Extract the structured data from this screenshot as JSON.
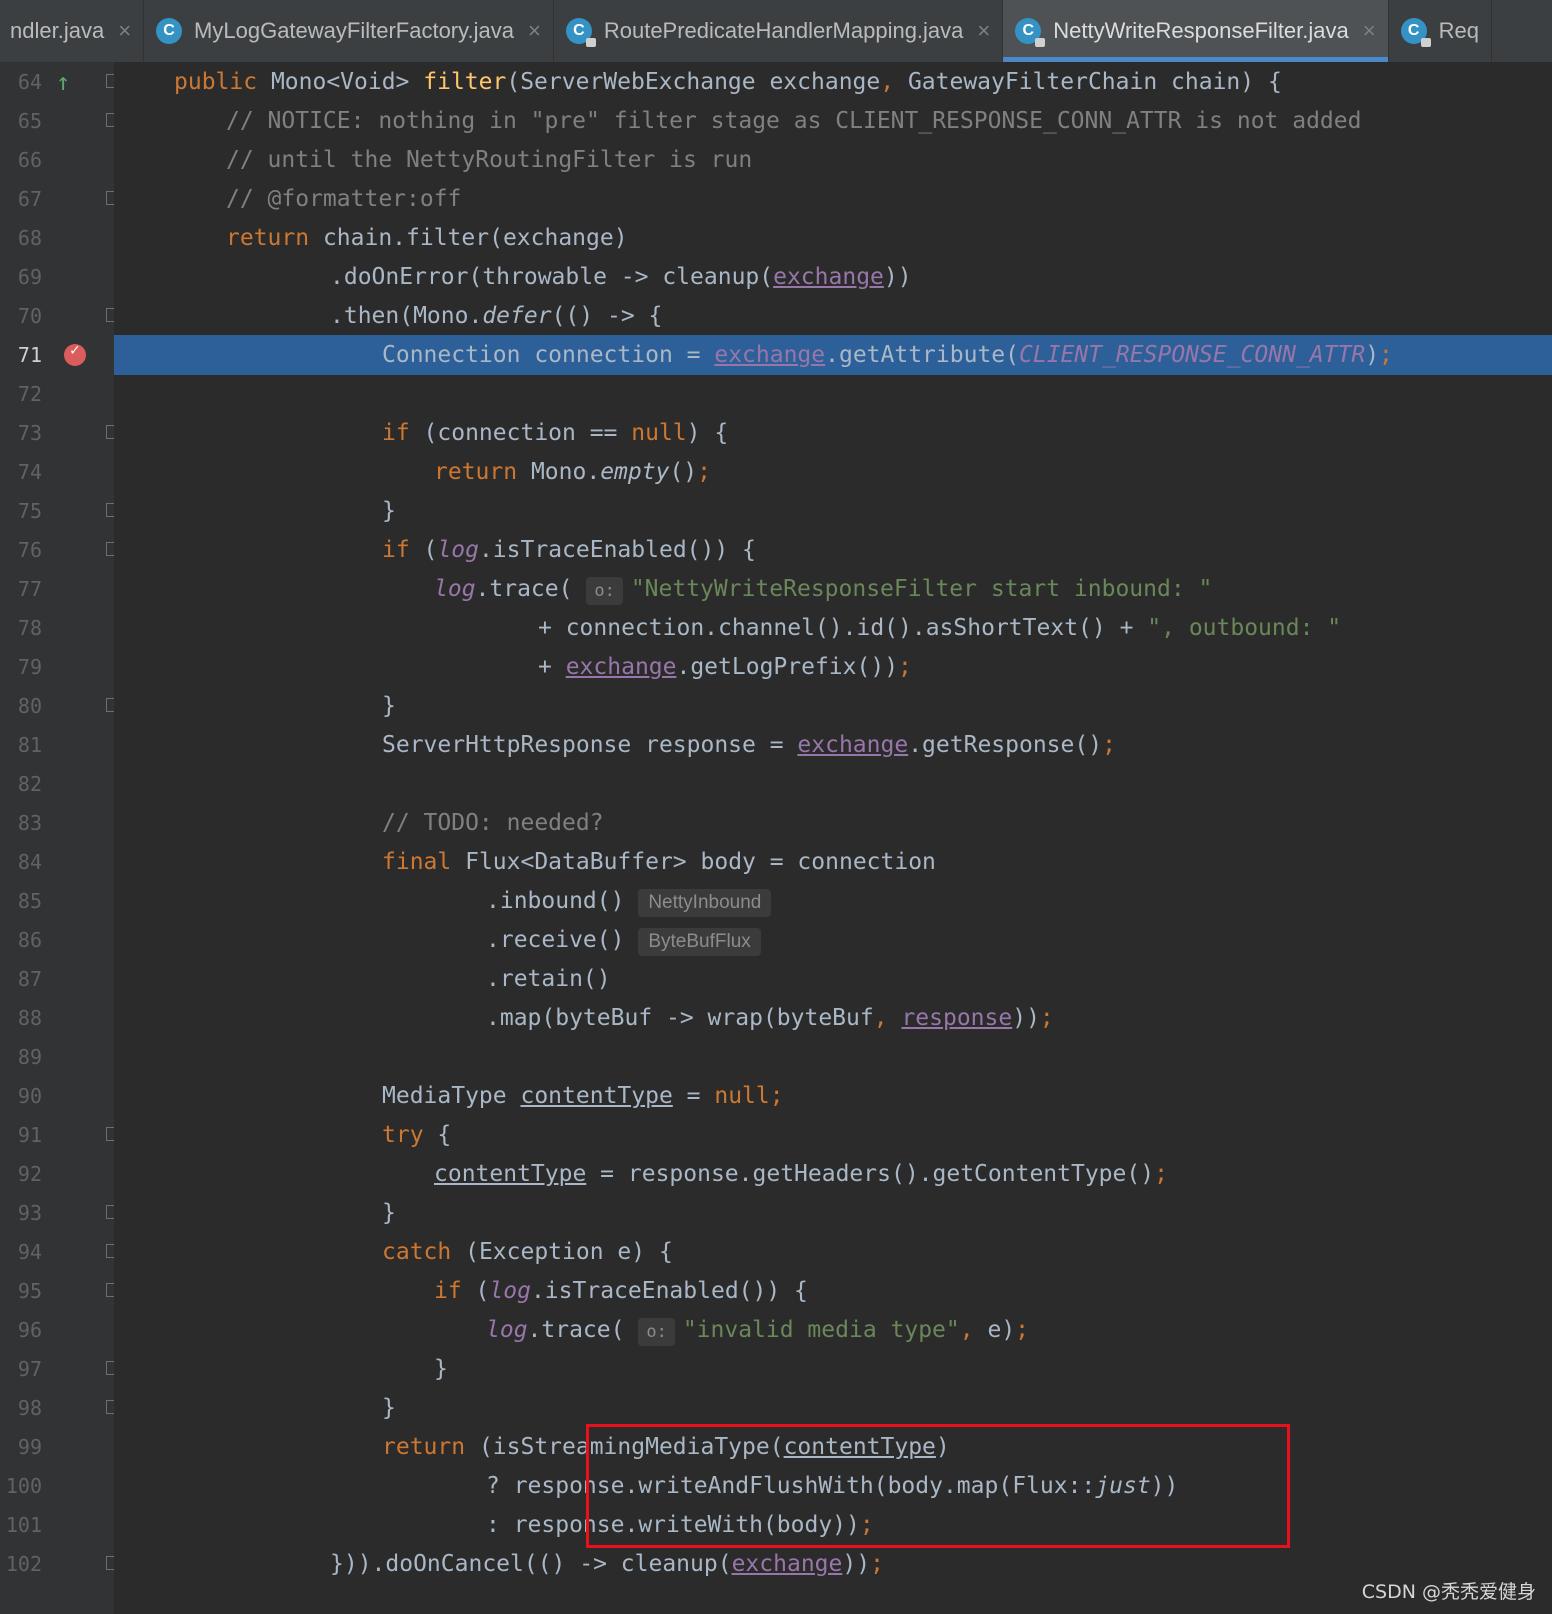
{
  "tabs": [
    {
      "label": "ndler.java",
      "icon": null,
      "active": false,
      "closable": true
    },
    {
      "label": "MyLogGatewayFilterFactory.java",
      "icon": "class-icon",
      "active": false,
      "closable": true
    },
    {
      "label": "RoutePredicateHandlerMapping.java",
      "icon": "locked-class-icon",
      "active": false,
      "closable": true
    },
    {
      "label": "NettyWriteResponseFilter.java",
      "icon": "locked-class-icon",
      "active": true,
      "closable": true
    },
    {
      "label": "Req",
      "icon": "locked-class-icon",
      "active": false,
      "closable": false
    }
  ],
  "tab_icon_glyph": "C",
  "close_glyph": "×",
  "current_line": 71,
  "breakpoint_line": 71,
  "override_marker_line": 64,
  "lines": [
    {
      "n": 64,
      "indent": 1,
      "tokens": [
        [
          "kw",
          "public "
        ],
        [
          "",
          "Mono<Void> "
        ],
        [
          "fn",
          "filter"
        ],
        [
          "",
          "(ServerWebExchange exchange"
        ],
        [
          "kw",
          ", "
        ],
        [
          "",
          "GatewayFilterChain chain) {"
        ]
      ]
    },
    {
      "n": 65,
      "indent": 2,
      "tokens": [
        [
          "cm",
          "// NOTICE: nothing in \"pre\" filter stage as CLIENT_RESPONSE_CONN_ATTR is not added"
        ]
      ]
    },
    {
      "n": 66,
      "indent": 2,
      "tokens": [
        [
          "cm",
          "// until the NettyRoutingFilter is run"
        ]
      ]
    },
    {
      "n": 67,
      "indent": 2,
      "tokens": [
        [
          "cm",
          "// @formatter:off"
        ]
      ]
    },
    {
      "n": 68,
      "indent": 2,
      "tokens": [
        [
          "kw",
          "return "
        ],
        [
          "",
          "chain.filter(exchange)"
        ]
      ]
    },
    {
      "n": 69,
      "indent": 4,
      "tokens": [
        [
          "",
          ".doOnError(throwable -> cleanup("
        ],
        [
          "ul",
          "exchange"
        ],
        [
          "",
          "))"
        ]
      ]
    },
    {
      "n": 70,
      "indent": 4,
      "tokens": [
        [
          "",
          ".then(Mono."
        ],
        [
          "it",
          "defer"
        ],
        [
          "",
          "(() -> {"
        ]
      ]
    },
    {
      "n": 71,
      "indent": 5,
      "tokens": [
        [
          "",
          "Connection connection = "
        ],
        [
          "ul",
          "exchange"
        ],
        [
          "",
          ".getAttribute("
        ],
        [
          "field",
          "CLIENT_RESPONSE_CONN_ATTR"
        ],
        [
          "",
          ")"
        ],
        [
          "kw",
          ";"
        ]
      ]
    },
    {
      "n": 72,
      "indent": 5,
      "tokens": []
    },
    {
      "n": 73,
      "indent": 5,
      "tokens": [
        [
          "kw",
          "if "
        ],
        [
          "",
          "(connection == "
        ],
        [
          "kw",
          "null"
        ],
        [
          "",
          ") {"
        ]
      ]
    },
    {
      "n": 74,
      "indent": 6,
      "tokens": [
        [
          "kw",
          "return "
        ],
        [
          "",
          "Mono."
        ],
        [
          "it",
          "empty"
        ],
        [
          "",
          "()"
        ],
        [
          "kw",
          ";"
        ]
      ]
    },
    {
      "n": 75,
      "indent": 5,
      "tokens": [
        [
          "",
          "}"
        ]
      ]
    },
    {
      "n": 76,
      "indent": 5,
      "tokens": [
        [
          "kw",
          "if "
        ],
        [
          "",
          "("
        ],
        [
          "field",
          "log"
        ],
        [
          "",
          ".isTraceEnabled()) {"
        ]
      ]
    },
    {
      "n": 77,
      "indent": 6,
      "tokens": [
        [
          "field",
          "log"
        ],
        [
          "",
          ".trace( "
        ],
        [
          "hinto",
          "o:"
        ],
        [
          "str",
          "\"NettyWriteResponseFilter start inbound: \""
        ]
      ]
    },
    {
      "n": 78,
      "indent": 8,
      "tokens": [
        [
          "",
          "+ connection.channel().id().asShortText() + "
        ],
        [
          "str",
          "\", outbound: \""
        ]
      ]
    },
    {
      "n": 79,
      "indent": 8,
      "tokens": [
        [
          "",
          "+ "
        ],
        [
          "ul",
          "exchange"
        ],
        [
          "",
          ".getLogPrefix())"
        ],
        [
          "kw",
          ";"
        ]
      ]
    },
    {
      "n": 80,
      "indent": 5,
      "tokens": [
        [
          "",
          "}"
        ]
      ]
    },
    {
      "n": 81,
      "indent": 5,
      "tokens": [
        [
          "",
          "ServerHttpResponse response = "
        ],
        [
          "ul",
          "exchange"
        ],
        [
          "",
          ".getResponse()"
        ],
        [
          "kw",
          ";"
        ]
      ]
    },
    {
      "n": 82,
      "indent": 5,
      "tokens": []
    },
    {
      "n": 83,
      "indent": 5,
      "tokens": [
        [
          "cm",
          "// TODO: needed?"
        ]
      ]
    },
    {
      "n": 84,
      "indent": 5,
      "tokens": [
        [
          "kw",
          "final "
        ],
        [
          "",
          "Flux<DataBuffer> body = connection"
        ]
      ]
    },
    {
      "n": 85,
      "indent": 7,
      "tokens": [
        [
          "",
          ".inbound() "
        ],
        [
          "hint",
          "NettyInbound"
        ]
      ]
    },
    {
      "n": 86,
      "indent": 7,
      "tokens": [
        [
          "",
          ".receive() "
        ],
        [
          "hint",
          "ByteBufFlux"
        ]
      ]
    },
    {
      "n": 87,
      "indent": 7,
      "tokens": [
        [
          "",
          ".retain()"
        ]
      ]
    },
    {
      "n": 88,
      "indent": 7,
      "tokens": [
        [
          "",
          ".map(byteBuf -> wrap(byteBuf"
        ],
        [
          "kw",
          ", "
        ],
        [
          "ul",
          "response"
        ],
        [
          "",
          "))"
        ],
        [
          "kw",
          ";"
        ]
      ]
    },
    {
      "n": 89,
      "indent": 5,
      "tokens": []
    },
    {
      "n": 90,
      "indent": 5,
      "tokens": [
        [
          "",
          "MediaType "
        ],
        [
          "ulw",
          "contentType"
        ],
        [
          "",
          " = "
        ],
        [
          "kw",
          "null;"
        ]
      ]
    },
    {
      "n": 91,
      "indent": 5,
      "tokens": [
        [
          "kw",
          "try "
        ],
        [
          "",
          "{"
        ]
      ]
    },
    {
      "n": 92,
      "indent": 6,
      "tokens": [
        [
          "ulw",
          "contentType"
        ],
        [
          "",
          " = response.getHeaders().getContentType()"
        ],
        [
          "kw",
          ";"
        ]
      ]
    },
    {
      "n": 93,
      "indent": 5,
      "tokens": [
        [
          "",
          "}"
        ]
      ]
    },
    {
      "n": 94,
      "indent": 5,
      "tokens": [
        [
          "kw",
          "catch "
        ],
        [
          "",
          "(Exception e) {"
        ]
      ]
    },
    {
      "n": 95,
      "indent": 6,
      "tokens": [
        [
          "kw",
          "if "
        ],
        [
          "",
          "("
        ],
        [
          "field",
          "log"
        ],
        [
          "",
          ".isTraceEnabled()) {"
        ]
      ]
    },
    {
      "n": 96,
      "indent": 7,
      "tokens": [
        [
          "field",
          "log"
        ],
        [
          "",
          ".trace( "
        ],
        [
          "hinto",
          "o:"
        ],
        [
          "str",
          "\"invalid media type\""
        ],
        [
          "kw",
          ", "
        ],
        [
          "",
          "e)"
        ],
        [
          "kw",
          ";"
        ]
      ]
    },
    {
      "n": 97,
      "indent": 6,
      "tokens": [
        [
          "",
          "}"
        ]
      ]
    },
    {
      "n": 98,
      "indent": 5,
      "tokens": [
        [
          "",
          "}"
        ]
      ]
    },
    {
      "n": 99,
      "indent": 5,
      "tokens": [
        [
          "kw",
          "return "
        ],
        [
          "",
          "(isStreamingMediaType("
        ],
        [
          "ulw",
          "contentType"
        ],
        [
          "",
          ")"
        ]
      ]
    },
    {
      "n": 100,
      "indent": 7,
      "tokens": [
        [
          "",
          "? response.writeAndFlushWith(body.map(Flux::"
        ],
        [
          "it",
          "just"
        ],
        [
          "",
          "))"
        ]
      ]
    },
    {
      "n": 101,
      "indent": 7,
      "tokens": [
        [
          "",
          ": response.writeWith(body))"
        ],
        [
          "kw",
          ";"
        ]
      ]
    },
    {
      "n": 102,
      "indent": 4,
      "tokens": [
        [
          "",
          "})).doOnCancel(() -> cleanup("
        ],
        [
          "ul",
          "exchange"
        ],
        [
          "",
          "))"
        ],
        [
          "kw",
          ";"
        ]
      ]
    }
  ],
  "fold_lines": [
    64,
    65,
    67,
    70,
    73,
    75,
    76,
    80,
    91,
    93,
    94,
    95,
    97,
    98,
    102
  ],
  "highlight_box_lines": [
    99,
    100,
    101
  ],
  "colors": {
    "background": "#2b2b2b",
    "gutter": "#313335",
    "current_line": "#2d6099",
    "keyword": "#cc7832",
    "comment": "#808080",
    "string": "#6a8759",
    "method_decl": "#ffc66d",
    "field": "#9876aa",
    "breakpoint": "#db5c5c",
    "highlight_box": "#e8101b"
  },
  "watermark": "CSDN @秃秃爱健身"
}
